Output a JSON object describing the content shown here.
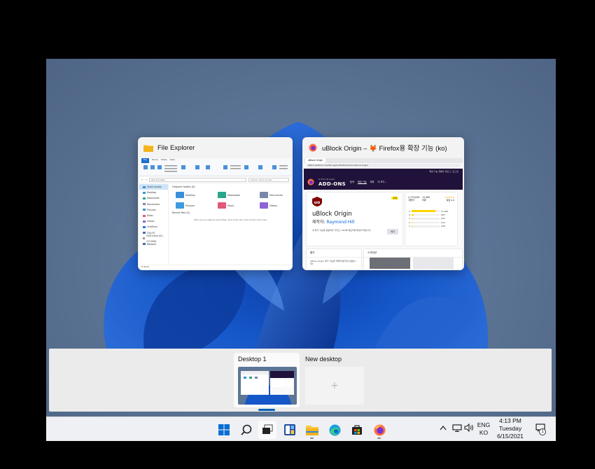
{
  "explorer": {
    "title": "File Explorer",
    "ribbon_tabs": [
      "File",
      "Home",
      "Share",
      "View"
    ],
    "address": "Quick access",
    "search_placeholder": "Search Quick access",
    "frequent_header": "Frequent folders (8)",
    "recent_header": "Recent files (0)",
    "recent_empty": "After you've opened some files, we'll show the most recent ones here.",
    "status": "8 items",
    "nav": [
      "Quick access",
      "Desktop",
      "Downloads",
      "Documents",
      "Pictures",
      "Music",
      "Videos",
      "OneDrive",
      "This PC",
      "DVD Drive (D:) CCCOMA",
      "Network"
    ],
    "folders": [
      {
        "name": "Desktop",
        "sub": "This PC",
        "color": "#3b8fd8"
      },
      {
        "name": "Downloads",
        "sub": "This PC",
        "color": "#2aa68a"
      },
      {
        "name": "Documents",
        "sub": "This PC",
        "color": "#7a88a8"
      },
      {
        "name": "Pictures",
        "sub": "This PC",
        "color": "#3d9be0"
      },
      {
        "name": "Music",
        "sub": "This PC",
        "color": "#e0577a"
      },
      {
        "name": "Videos",
        "sub": "This PC",
        "color": "#8f62d6"
      }
    ]
  },
  "firefox": {
    "title": "uBlock Origin – 🦊 Firefox용 확장 기능 (ko)",
    "tab_label": "uBlock Origin",
    "url": "https://addons.mozilla.org/ko/firefox/addon/ublock-origin/",
    "top_links": "확장 기능 개발자 블로그 | 로그인",
    "logo_small": "Firefox Browser",
    "logo_big": "ADD-ONS",
    "menu": [
      "탐색",
      "확장 기능",
      "테마",
      "더 보기…"
    ],
    "addon_name": "uBlock Origin",
    "author_prefix": "제작자: ",
    "author": "Raymond Hill",
    "badge": "추천",
    "summary": "이 부가 기능을 유용하다 가지고, CPU와 메모리에 부담이 적습니다.",
    "remove_label": "제거",
    "users": "4,779,836",
    "users_label": "사용자",
    "reviews": "13,460",
    "reviews_label": "리뷰",
    "rating_label": "평점 4.8",
    "ratings": [
      {
        "star": "5",
        "count": "11,625",
        "frac": 0.86
      },
      {
        "star": "4",
        "count": "953",
        "frac": 0.07
      },
      {
        "star": "3",
        "count": "247",
        "frac": 0.02
      },
      {
        "star": "2",
        "count": "110",
        "frac": 0.01
      },
      {
        "star": "1",
        "count": "249",
        "frac": 0.02
      }
    ],
    "rate_title": "평가",
    "rate_text": "uBlock Origin 부가 기능을 어떻게 평가하시겠습니까?",
    "shots_title": "스크린샷"
  },
  "desktops": {
    "current_label": "Desktop 1",
    "new_label": "New desktop",
    "new_icon": "+"
  },
  "taskbar": {
    "lang_top": "ENG",
    "lang_bottom": "KO",
    "time": "4:13 PM",
    "day": "Tuesday",
    "date": "6/15/2021",
    "notification_count": "1",
    "apps": [
      "start-icon",
      "search-icon",
      "task-view-icon",
      "widgets-icon",
      "file-explorer-icon",
      "edge-icon",
      "store-icon",
      "firefox-icon"
    ]
  }
}
